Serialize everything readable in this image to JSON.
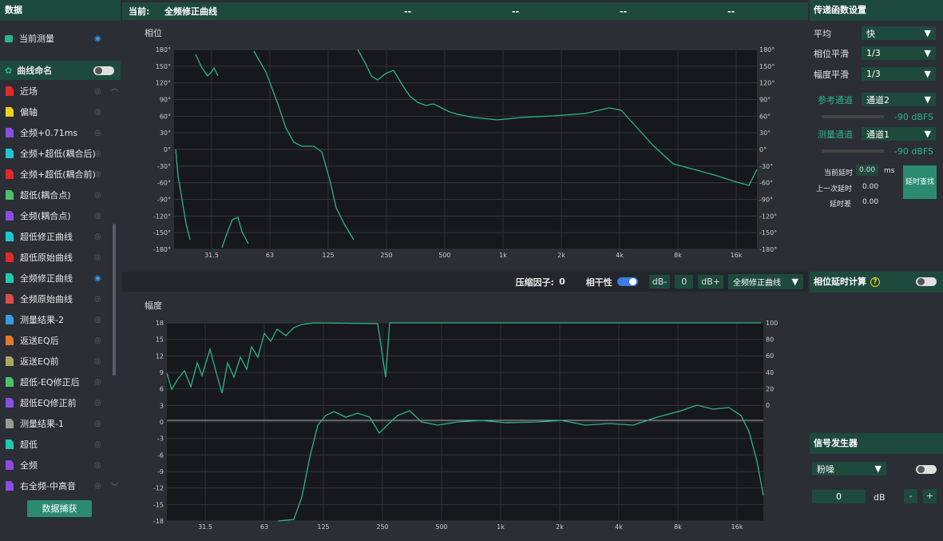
{
  "left": {
    "title": "数据",
    "current_label": "当前测量",
    "naming_label": "曲线命名",
    "capture_button": "数据捕获",
    "items": [
      {
        "label": "近场",
        "color": "#e02a2a",
        "visible": false
      },
      {
        "label": "偏轴",
        "color": "#e8d21a",
        "visible": false
      },
      {
        "label": "全频+0.71ms",
        "color": "#8a4de0",
        "visible": false
      },
      {
        "label": "全频+超低(耦合后)",
        "color": "#1fc8d0",
        "visible": false
      },
      {
        "label": "全频+超低(耦合前)",
        "color": "#e02a2a",
        "visible": false
      },
      {
        "label": "超低(耦合点)",
        "color": "#4cc06a",
        "visible": false
      },
      {
        "label": "全频(耦合点)",
        "color": "#8a4de0",
        "visible": false
      },
      {
        "label": "超低修正曲线",
        "color": "#1fc8d0",
        "visible": false
      },
      {
        "label": "超低原始曲线",
        "color": "#e02a2a",
        "visible": false
      },
      {
        "label": "全频修正曲线",
        "color": "#1fc8b0",
        "visible": true
      },
      {
        "label": "全频原始曲线",
        "color": "#e04a4a",
        "visible": false
      },
      {
        "label": "测量结果-2",
        "color": "#3b9ae1",
        "visible": false
      },
      {
        "label": "返送EQ后",
        "color": "#e07a2a",
        "visible": false
      },
      {
        "label": "返送EQ前",
        "color": "#a8a860",
        "visible": false
      },
      {
        "label": "超低-EQ修正后",
        "color": "#4cc06a",
        "visible": false
      },
      {
        "label": "超低EQ修正前",
        "color": "#8a4de0",
        "visible": false
      },
      {
        "label": "测量结果-1",
        "color": "#999999",
        "visible": false
      },
      {
        "label": "超低",
        "color": "#1fc8b0",
        "visible": false
      },
      {
        "label": "全频",
        "color": "#8a4de0",
        "visible": false
      },
      {
        "label": "右全频-中高音",
        "color": "#8a4de0",
        "visible": false
      }
    ]
  },
  "top": {
    "current_label": "当前:",
    "current_value": "全频修正曲线",
    "placeholders": [
      "--",
      "--",
      "--",
      "--"
    ]
  },
  "phase_plot": {
    "title": "相位",
    "y_ticks_left": [
      "180°",
      "150°",
      "120°",
      "90°",
      "60°",
      "30°",
      "0°",
      "-30°",
      "-60°",
      "-90°",
      "-120°",
      "-150°",
      "-180°"
    ],
    "y_ticks_right": [
      "180°",
      "150°",
      "120°",
      "90°",
      "60°",
      "30°",
      "0°",
      "-30°",
      "-60°",
      "-90°",
      "-120°",
      "-150°",
      "-180°"
    ],
    "x_ticks": [
      "31.5",
      "63",
      "125",
      "250",
      "500",
      "1k",
      "2k",
      "4k",
      "8k",
      "16k"
    ]
  },
  "controls": {
    "compression_label": "压缩因子:",
    "compression_value": "0",
    "coherence_label": "相干性",
    "db_minus": "dB-",
    "db_value": "0",
    "db_plus": "dB+",
    "curve_select": "全频修正曲线"
  },
  "mag_plot": {
    "title": "幅度",
    "y_ticks_left": [
      "18",
      "15",
      "12",
      "9",
      "6",
      "3",
      "0",
      "-3",
      "-6",
      "-9",
      "-12",
      "-15",
      "-18"
    ],
    "y_ticks_right": [
      "100",
      "80",
      "60",
      "40",
      "20",
      "0"
    ],
    "x_ticks": [
      "31.5",
      "63",
      "125",
      "250",
      "500",
      "1k",
      "2k",
      "4k",
      "8k",
      "16k"
    ]
  },
  "right": {
    "title": "传递函数设置",
    "avg_label": "平均",
    "avg_value": "快",
    "phase_smooth_label": "相位平滑",
    "phase_smooth_value": "1/3",
    "mag_smooth_label": "幅度平滑",
    "mag_smooth_value": "1/3",
    "ref_channel_label": "参考通道",
    "ref_channel_value": "通道2",
    "ref_level": "-90 dBFS",
    "meas_channel_label": "测量通道",
    "meas_channel_value": "通道1",
    "meas_level": "-90 dBFS",
    "cur_delay_label": "当前延时",
    "cur_delay_value": "0.00",
    "cur_delay_unit": "ms",
    "last_delay_label": "上一次延时",
    "last_delay_value": "0.00",
    "delay_diff_label": "延时差",
    "delay_diff_value": "0.00",
    "delay_find_button": "延时查找",
    "phase_delay_title": "相位延时计算",
    "signal_title": "信号发生器",
    "signal_type": "粉噪",
    "signal_level": "0",
    "signal_unit": "dB",
    "minus": "-",
    "plus": "+"
  },
  "colors": {
    "accent": "#1e4a3d",
    "trace": "#2ab58a",
    "grid": "#3a3d44",
    "plot_bg": "#16181c"
  }
}
